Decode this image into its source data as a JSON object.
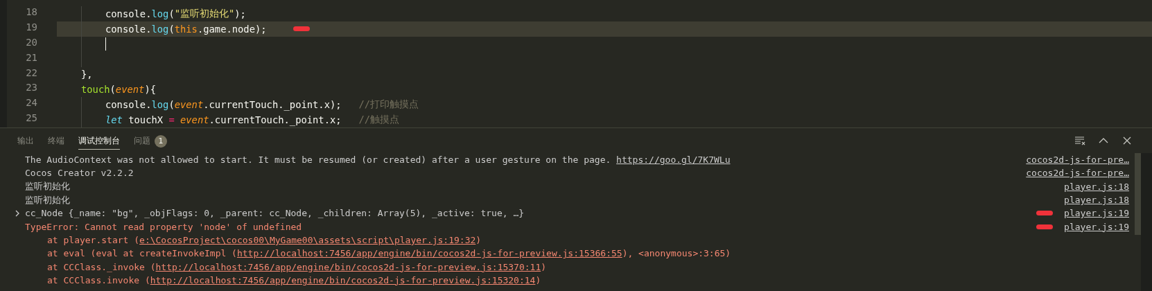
{
  "editor": {
    "lines": [
      {
        "number": "18",
        "kind": "statement",
        "current": false,
        "cursor": false,
        "marked": false,
        "tokens": [
          {
            "text": "console.",
            "kind": "plain"
          },
          {
            "text": "log",
            "kind": "function"
          },
          {
            "text": "(",
            "kind": "plain"
          },
          {
            "text": "\"监听初始化\"",
            "kind": "string"
          },
          {
            "text": ");",
            "kind": "plain"
          }
        ]
      },
      {
        "number": "19",
        "kind": "statement",
        "current": true,
        "cursor": false,
        "marked": true,
        "tokens": [
          {
            "text": "console.",
            "kind": "plain"
          },
          {
            "text": "log",
            "kind": "function"
          },
          {
            "text": "(",
            "kind": "plain"
          },
          {
            "text": "this",
            "kind": "this"
          },
          {
            "text": ".game.node);",
            "kind": "plain"
          }
        ]
      },
      {
        "number": "20",
        "kind": "statement",
        "current": false,
        "cursor": true,
        "marked": false
      },
      {
        "number": "21",
        "kind": "blank",
        "current": false,
        "cursor": false,
        "marked": false
      },
      {
        "number": "22",
        "kind": "member",
        "current": false,
        "cursor": false,
        "marked": false,
        "tokens": [
          {
            "text": "},",
            "kind": "plain"
          }
        ]
      },
      {
        "number": "23",
        "kind": "member",
        "current": false,
        "cursor": false,
        "marked": false,
        "tokens": [
          {
            "text": "touch",
            "kind": "function-name"
          },
          {
            "text": "(",
            "kind": "plain"
          },
          {
            "text": "event",
            "kind": "param"
          },
          {
            "text": "){",
            "kind": "plain"
          }
        ]
      },
      {
        "number": "24",
        "kind": "statement",
        "current": false,
        "cursor": false,
        "marked": false,
        "tokens": [
          {
            "text": "console.",
            "kind": "plain"
          },
          {
            "text": "log",
            "kind": "function"
          },
          {
            "text": "(",
            "kind": "plain"
          },
          {
            "text": "event",
            "kind": "param"
          },
          {
            "text": ".currentTouch._point.x);   ",
            "kind": "plain"
          },
          {
            "text": "//打印触摸点",
            "kind": "comment"
          }
        ]
      },
      {
        "number": "25",
        "kind": "statement",
        "current": false,
        "cursor": false,
        "marked": false,
        "tokens": [
          {
            "text": "let",
            "kind": "keyword"
          },
          {
            "text": " touchX ",
            "kind": "plain"
          },
          {
            "text": "=",
            "kind": "operator"
          },
          {
            "text": " event",
            "kind": "param"
          },
          {
            "text": ".currentTouch._point.x;   ",
            "kind": "plain"
          },
          {
            "text": "//触摸点",
            "kind": "comment"
          }
        ]
      }
    ]
  },
  "panel": {
    "tabs": [
      {
        "label": "输出",
        "selected": false
      },
      {
        "label": "终端",
        "selected": false
      },
      {
        "label": "调试控制台",
        "selected": true
      },
      {
        "label": "问题",
        "selected": false,
        "badge": "1"
      }
    ],
    "console": [
      {
        "kind": "info",
        "expandable": false,
        "marked": false,
        "source": "cocos2d-js-for-pre…",
        "segments": [
          {
            "text": "The AudioContext was not allowed to start. It must be resumed (or created) after a user gesture on the page. ",
            "kind": "text"
          },
          {
            "text": "https://goo.gl/7K7WLu",
            "kind": "link"
          }
        ]
      },
      {
        "kind": "info",
        "expandable": false,
        "marked": false,
        "source": "cocos2d-js-for-pre…",
        "segments": [
          {
            "text": "Cocos Creator v2.2.2",
            "kind": "text"
          }
        ]
      },
      {
        "kind": "info",
        "expandable": false,
        "marked": false,
        "source": "player.js:18",
        "segments": [
          {
            "text": "监听初始化",
            "kind": "text"
          }
        ]
      },
      {
        "kind": "info",
        "expandable": false,
        "marked": false,
        "source": "player.js:18",
        "segments": [
          {
            "text": "监听初始化",
            "kind": "text"
          }
        ]
      },
      {
        "kind": "info",
        "expandable": true,
        "marked": true,
        "source": "player.js:19",
        "segments": [
          {
            "text": "cc_Node {_name: \"bg\", _objFlags: 0, _parent: cc_Node, _children: Array(5), _active: true, …}",
            "kind": "text"
          }
        ]
      },
      {
        "kind": "error",
        "expandable": false,
        "marked": true,
        "source": "player.js:19",
        "segments": [
          {
            "text": "TypeError: Cannot read property 'node' of undefined",
            "kind": "text"
          }
        ]
      },
      {
        "kind": "stack",
        "expandable": false,
        "marked": false,
        "segments": [
          {
            "text": "at player.start (",
            "kind": "text"
          },
          {
            "text": "e:\\CocosProject\\cocos00\\MyGame00\\assets\\script\\player.js:19:32",
            "kind": "link"
          },
          {
            "text": ")",
            "kind": "text"
          }
        ]
      },
      {
        "kind": "stack",
        "expandable": false,
        "marked": false,
        "segments": [
          {
            "text": "at eval (eval at createInvokeImpl (",
            "kind": "text"
          },
          {
            "text": "http://localhost:7456/app/engine/bin/cocos2d-js-for-preview.js:15366:55",
            "kind": "link"
          },
          {
            "text": "), <anonymous>:3:65)",
            "kind": "text"
          }
        ]
      },
      {
        "kind": "stack",
        "expandable": false,
        "marked": false,
        "segments": [
          {
            "text": "at CCClass._invoke (",
            "kind": "text"
          },
          {
            "text": "http://localhost:7456/app/engine/bin/cocos2d-js-for-preview.js:15370:11",
            "kind": "link"
          },
          {
            "text": ")",
            "kind": "text"
          }
        ]
      },
      {
        "kind": "stack",
        "expandable": false,
        "marked": false,
        "segments": [
          {
            "text": "at CCClass.invoke (",
            "kind": "text"
          },
          {
            "text": "http://localhost:7456/app/engine/bin/cocos2d-js-for-preview.js:15320:14",
            "kind": "link"
          },
          {
            "text": ")",
            "kind": "text"
          }
        ]
      }
    ]
  }
}
